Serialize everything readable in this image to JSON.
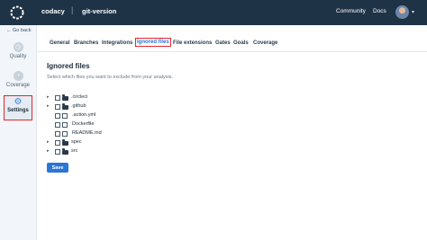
{
  "header": {
    "org": "codacy",
    "repo": "git-version",
    "community": "Community",
    "docs": "Docs"
  },
  "sidebar": {
    "back": "← Go back",
    "items": [
      {
        "label": "Quality"
      },
      {
        "label": "Coverage"
      },
      {
        "label": "Settings"
      }
    ]
  },
  "tabs": [
    "General",
    "Branches",
    "Integrations",
    "Ignored files",
    "File extensions",
    "Gates",
    "Goals",
    "Coverage"
  ],
  "active_tab": "Ignored files",
  "main": {
    "title": "Ignored files",
    "subtitle": "Select which files you want to exclude from your analysis.",
    "tree": [
      {
        "name": ".circleci",
        "type": "folder"
      },
      {
        "name": ".github",
        "type": "folder"
      },
      {
        "name": ".action.yml",
        "type": "file"
      },
      {
        "name": "Dockerfile",
        "type": "file"
      },
      {
        "name": "README.md",
        "type": "file"
      },
      {
        "name": "spec",
        "type": "folder"
      },
      {
        "name": "src",
        "type": "folder"
      }
    ],
    "save_label": "Save"
  },
  "colors": {
    "topbar": "#1f3347",
    "accent": "#2a75d6",
    "highlight": "#e0262f"
  }
}
